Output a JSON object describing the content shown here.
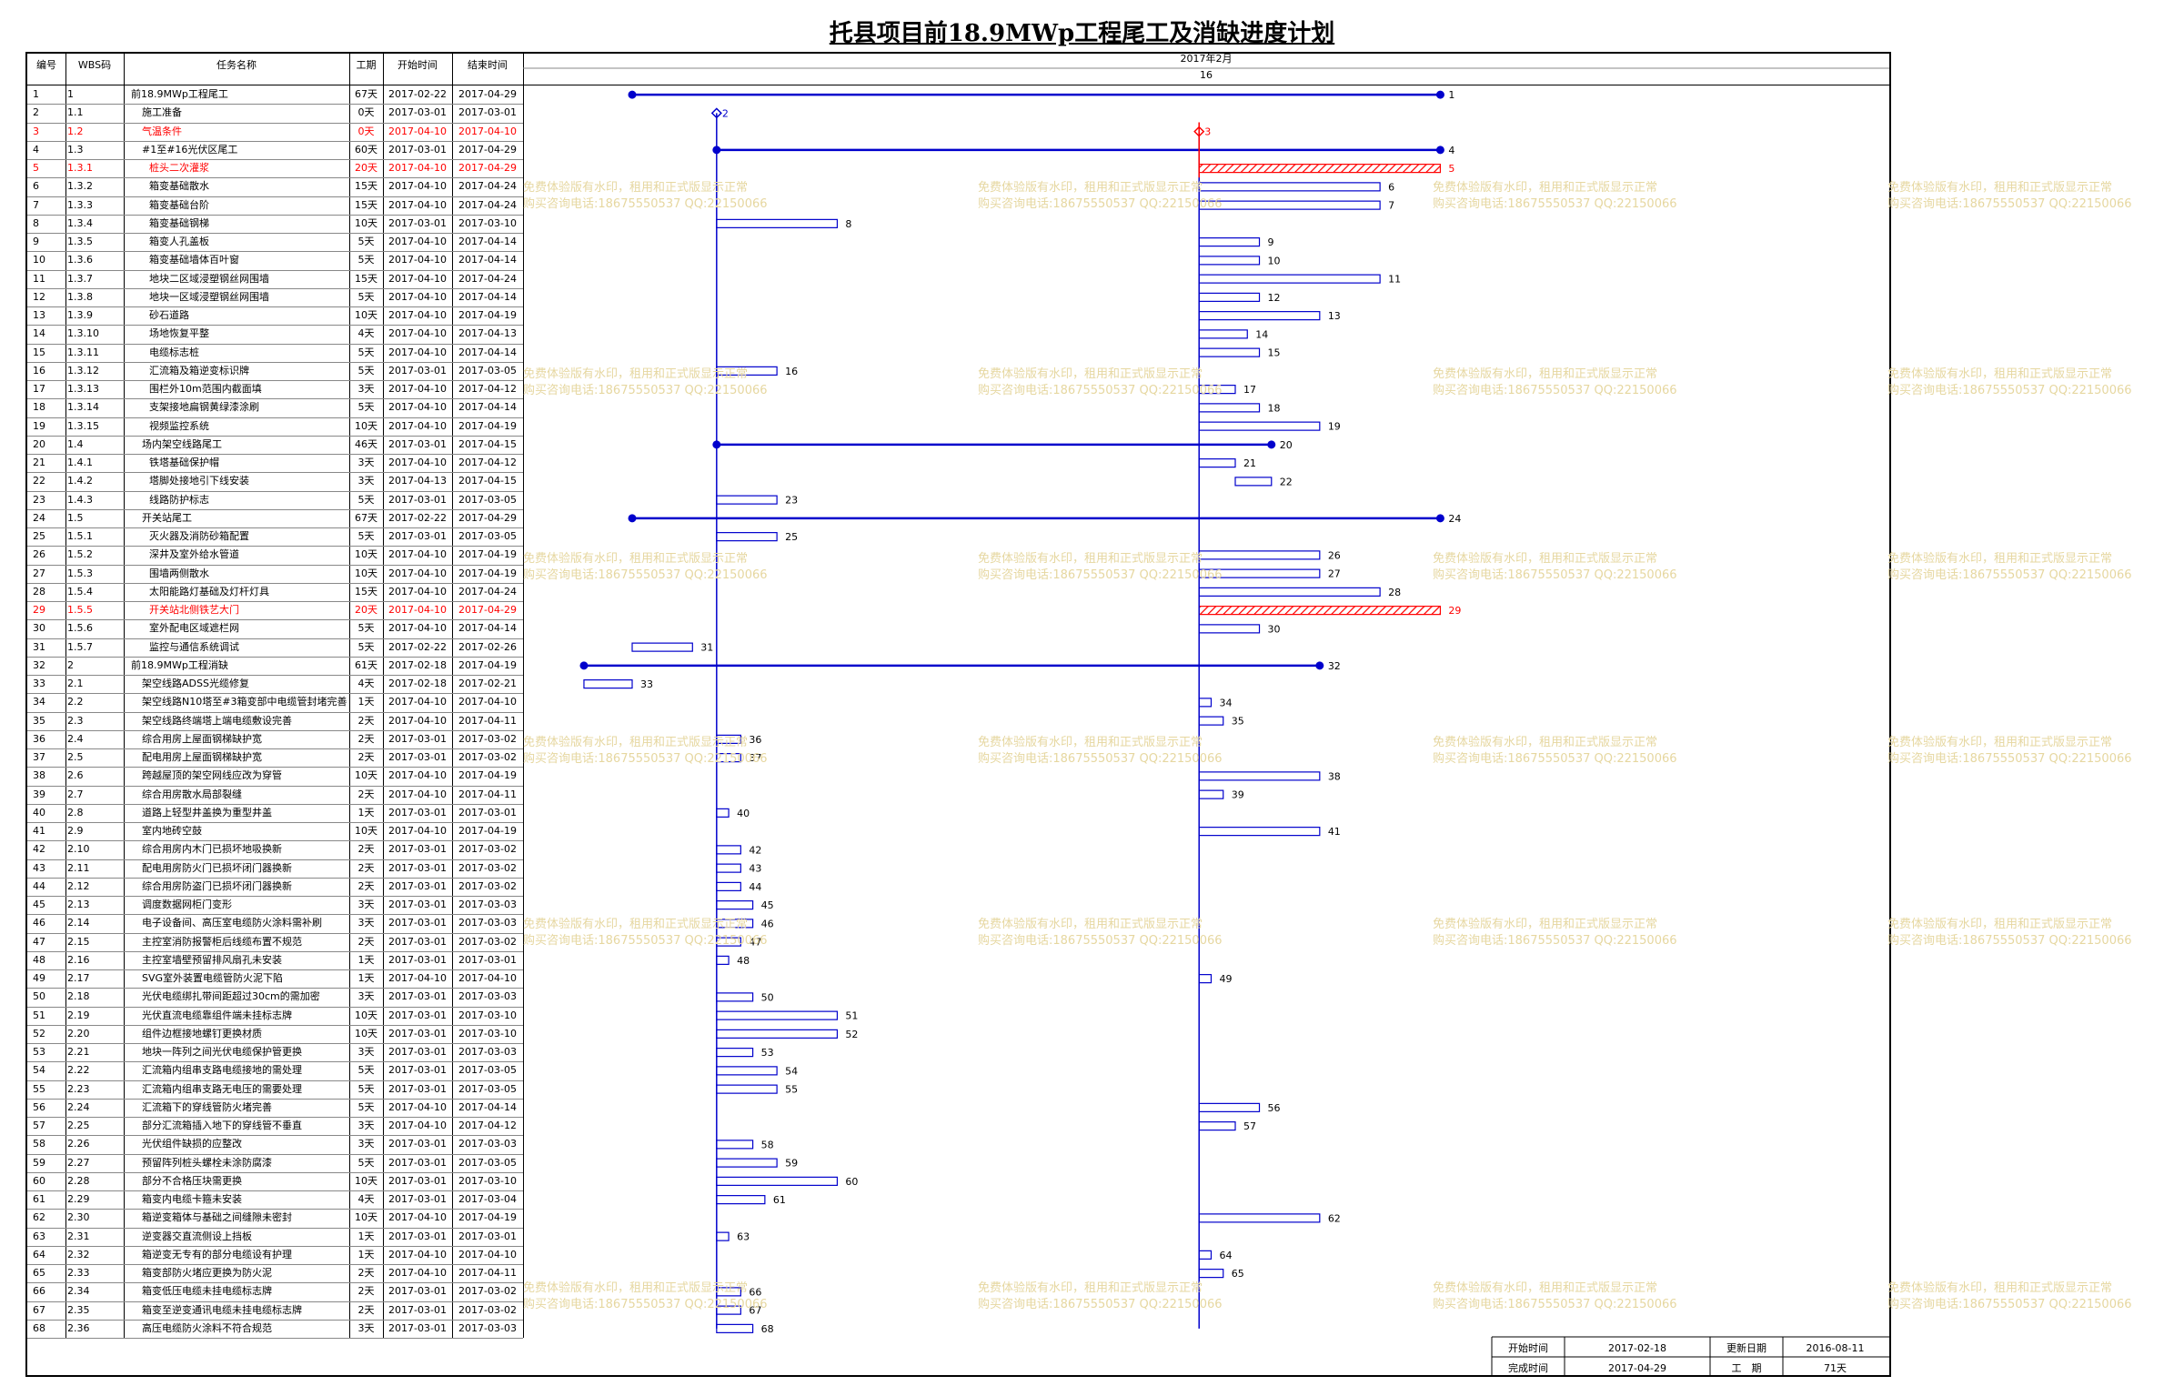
{
  "title": "托县项目前18.9MWp工程尾工及消缺进度计划",
  "headers": {
    "no": "编号",
    "wbs": "WBS码",
    "name": "任务名称",
    "dur": "工期",
    "start": "开始时间",
    "end": "结束时间",
    "month": "2017年2月",
    "week": "16"
  },
  "tasks": [
    {
      "no": "1",
      "wbs": "1",
      "name": "前18.9MWp工程尾工",
      "dur": "67天",
      "start": "2017-02-22",
      "end": "2017-04-29",
      "kind": "summary",
      "indent": 0
    },
    {
      "no": "2",
      "wbs": "1.1",
      "name": "施工准备",
      "dur": "0天",
      "start": "2017-03-01",
      "end": "2017-03-01",
      "kind": "milestone",
      "indent": 1
    },
    {
      "no": "3",
      "wbs": "1.2",
      "name": "气温条件",
      "dur": "0天",
      "start": "2017-04-10",
      "end": "2017-04-10",
      "kind": "milestone",
      "indent": 1,
      "critical": true
    },
    {
      "no": "4",
      "wbs": "1.3",
      "name": "#1至#16光伏区尾工",
      "dur": "60天",
      "start": "2017-03-01",
      "end": "2017-04-29",
      "kind": "summary",
      "indent": 1
    },
    {
      "no": "5",
      "wbs": "1.3.1",
      "name": "桩头二次灌浆",
      "dur": "20天",
      "start": "2017-04-10",
      "end": "2017-04-29",
      "kind": "task",
      "indent": 2,
      "critical": true
    },
    {
      "no": "6",
      "wbs": "1.3.2",
      "name": "箱变基础散水",
      "dur": "15天",
      "start": "2017-04-10",
      "end": "2017-04-24",
      "kind": "task",
      "indent": 2
    },
    {
      "no": "7",
      "wbs": "1.3.3",
      "name": "箱变基础台阶",
      "dur": "15天",
      "start": "2017-04-10",
      "end": "2017-04-24",
      "kind": "task",
      "indent": 2
    },
    {
      "no": "8",
      "wbs": "1.3.4",
      "name": "箱变基础钢梯",
      "dur": "10天",
      "start": "2017-03-01",
      "end": "2017-03-10",
      "kind": "task",
      "indent": 2
    },
    {
      "no": "9",
      "wbs": "1.3.5",
      "name": "箱变人孔盖板",
      "dur": "5天",
      "start": "2017-04-10",
      "end": "2017-04-14",
      "kind": "task",
      "indent": 2
    },
    {
      "no": "10",
      "wbs": "1.3.6",
      "name": "箱变基础墙体百叶窗",
      "dur": "5天",
      "start": "2017-04-10",
      "end": "2017-04-14",
      "kind": "task",
      "indent": 2
    },
    {
      "no": "11",
      "wbs": "1.3.7",
      "name": "地块二区域浸塑钢丝网围墙",
      "dur": "15天",
      "start": "2017-04-10",
      "end": "2017-04-24",
      "kind": "task",
      "indent": 2
    },
    {
      "no": "12",
      "wbs": "1.3.8",
      "name": "地块一区域浸塑钢丝网围墙",
      "dur": "5天",
      "start": "2017-04-10",
      "end": "2017-04-14",
      "kind": "task",
      "indent": 2
    },
    {
      "no": "13",
      "wbs": "1.3.9",
      "name": "砂石道路",
      "dur": "10天",
      "start": "2017-04-10",
      "end": "2017-04-19",
      "kind": "task",
      "indent": 2
    },
    {
      "no": "14",
      "wbs": "1.3.10",
      "name": "场地恢复平整",
      "dur": "4天",
      "start": "2017-04-10",
      "end": "2017-04-13",
      "kind": "task",
      "indent": 2
    },
    {
      "no": "15",
      "wbs": "1.3.11",
      "name": "电缆标志桩",
      "dur": "5天",
      "start": "2017-04-10",
      "end": "2017-04-14",
      "kind": "task",
      "indent": 2
    },
    {
      "no": "16",
      "wbs": "1.3.12",
      "name": "汇流箱及箱逆变标识牌",
      "dur": "5天",
      "start": "2017-03-01",
      "end": "2017-03-05",
      "kind": "task",
      "indent": 2
    },
    {
      "no": "17",
      "wbs": "1.3.13",
      "name": "围栏外10m范围内截面填",
      "dur": "3天",
      "start": "2017-04-10",
      "end": "2017-04-12",
      "kind": "task",
      "indent": 2
    },
    {
      "no": "18",
      "wbs": "1.3.14",
      "name": "支架接地扁钢黄绿漆涂刷",
      "dur": "5天",
      "start": "2017-04-10",
      "end": "2017-04-14",
      "kind": "task",
      "indent": 2
    },
    {
      "no": "19",
      "wbs": "1.3.15",
      "name": "视频监控系统",
      "dur": "10天",
      "start": "2017-04-10",
      "end": "2017-04-19",
      "kind": "task",
      "indent": 2
    },
    {
      "no": "20",
      "wbs": "1.4",
      "name": "场内架空线路尾工",
      "dur": "46天",
      "start": "2017-03-01",
      "end": "2017-04-15",
      "kind": "summary",
      "indent": 1
    },
    {
      "no": "21",
      "wbs": "1.4.1",
      "name": "铁塔基础保护帽",
      "dur": "3天",
      "start": "2017-04-10",
      "end": "2017-04-12",
      "kind": "task",
      "indent": 2
    },
    {
      "no": "22",
      "wbs": "1.4.2",
      "name": "塔脚处接地引下线安装",
      "dur": "3天",
      "start": "2017-04-13",
      "end": "2017-04-15",
      "kind": "task",
      "indent": 2
    },
    {
      "no": "23",
      "wbs": "1.4.3",
      "name": "线路防护标志",
      "dur": "5天",
      "start": "2017-03-01",
      "end": "2017-03-05",
      "kind": "task",
      "indent": 2
    },
    {
      "no": "24",
      "wbs": "1.5",
      "name": "开关站尾工",
      "dur": "67天",
      "start": "2017-02-22",
      "end": "2017-04-29",
      "kind": "summary",
      "indent": 1
    },
    {
      "no": "25",
      "wbs": "1.5.1",
      "name": "灭火器及消防砂箱配置",
      "dur": "5天",
      "start": "2017-03-01",
      "end": "2017-03-05",
      "kind": "task",
      "indent": 2
    },
    {
      "no": "26",
      "wbs": "1.5.2",
      "name": "深井及室外给水管道",
      "dur": "10天",
      "start": "2017-04-10",
      "end": "2017-04-19",
      "kind": "task",
      "indent": 2
    },
    {
      "no": "27",
      "wbs": "1.5.3",
      "name": "围墙两侧散水",
      "dur": "10天",
      "start": "2017-04-10",
      "end": "2017-04-19",
      "kind": "task",
      "indent": 2
    },
    {
      "no": "28",
      "wbs": "1.5.4",
      "name": "太阳能路灯基础及灯杆灯具",
      "dur": "15天",
      "start": "2017-04-10",
      "end": "2017-04-24",
      "kind": "task",
      "indent": 2
    },
    {
      "no": "29",
      "wbs": "1.5.5",
      "name": "开关站北侧铁艺大门",
      "dur": "20天",
      "start": "2017-04-10",
      "end": "2017-04-29",
      "kind": "task",
      "indent": 2,
      "critical": true
    },
    {
      "no": "30",
      "wbs": "1.5.6",
      "name": "室外配电区域遮栏网",
      "dur": "5天",
      "start": "2017-04-10",
      "end": "2017-04-14",
      "kind": "task",
      "indent": 2
    },
    {
      "no": "31",
      "wbs": "1.5.7",
      "name": "监控与通信系统调试",
      "dur": "5天",
      "start": "2017-02-22",
      "end": "2017-02-26",
      "kind": "task",
      "indent": 2
    },
    {
      "no": "32",
      "wbs": "2",
      "name": "前18.9MWp工程消缺",
      "dur": "61天",
      "start": "2017-02-18",
      "end": "2017-04-19",
      "kind": "summary",
      "indent": 0
    },
    {
      "no": "33",
      "wbs": "2.1",
      "name": "架空线路ADSS光缆修复",
      "dur": "4天",
      "start": "2017-02-18",
      "end": "2017-02-21",
      "kind": "task",
      "indent": 1
    },
    {
      "no": "34",
      "wbs": "2.2",
      "name": "架空线路N10塔至#3箱变部中电缆管封堵完善",
      "dur": "1天",
      "start": "2017-04-10",
      "end": "2017-04-10",
      "kind": "task",
      "indent": 1
    },
    {
      "no": "35",
      "wbs": "2.3",
      "name": "架空线路终端塔上端电缆敷设完善",
      "dur": "2天",
      "start": "2017-04-10",
      "end": "2017-04-11",
      "kind": "task",
      "indent": 1
    },
    {
      "no": "36",
      "wbs": "2.4",
      "name": "综合用房上屋面钢梯缺护宽",
      "dur": "2天",
      "start": "2017-03-01",
      "end": "2017-03-02",
      "kind": "task",
      "indent": 1
    },
    {
      "no": "37",
      "wbs": "2.5",
      "name": "配电用房上屋面钢梯缺护宽",
      "dur": "2天",
      "start": "2017-03-01",
      "end": "2017-03-02",
      "kind": "task",
      "indent": 1
    },
    {
      "no": "38",
      "wbs": "2.6",
      "name": "跨越屋顶的架空网线应改为穿管",
      "dur": "10天",
      "start": "2017-04-10",
      "end": "2017-04-19",
      "kind": "task",
      "indent": 1
    },
    {
      "no": "39",
      "wbs": "2.7",
      "name": "综合用房散水局部裂缝",
      "dur": "2天",
      "start": "2017-04-10",
      "end": "2017-04-11",
      "kind": "task",
      "indent": 1
    },
    {
      "no": "40",
      "wbs": "2.8",
      "name": "道路上轻型井盖换为重型井盖",
      "dur": "1天",
      "start": "2017-03-01",
      "end": "2017-03-01",
      "kind": "task",
      "indent": 1
    },
    {
      "no": "41",
      "wbs": "2.9",
      "name": "室内地砖空鼓",
      "dur": "10天",
      "start": "2017-04-10",
      "end": "2017-04-19",
      "kind": "task",
      "indent": 1
    },
    {
      "no": "42",
      "wbs": "2.10",
      "name": "综合用房内木门已损坏地吸换新",
      "dur": "2天",
      "start": "2017-03-01",
      "end": "2017-03-02",
      "kind": "task",
      "indent": 1
    },
    {
      "no": "43",
      "wbs": "2.11",
      "name": "配电用房防火门已损坏闭门器换新",
      "dur": "2天",
      "start": "2017-03-01",
      "end": "2017-03-02",
      "kind": "task",
      "indent": 1
    },
    {
      "no": "44",
      "wbs": "2.12",
      "name": "综合用房防盗门已损坏闭门器换新",
      "dur": "2天",
      "start": "2017-03-01",
      "end": "2017-03-02",
      "kind": "task",
      "indent": 1
    },
    {
      "no": "45",
      "wbs": "2.13",
      "name": "调度数据网柜门变形",
      "dur": "3天",
      "start": "2017-03-01",
      "end": "2017-03-03",
      "kind": "task",
      "indent": 1
    },
    {
      "no": "46",
      "wbs": "2.14",
      "name": "电子设备间、高压室电缆防火涂料需补刷",
      "dur": "3天",
      "start": "2017-03-01",
      "end": "2017-03-03",
      "kind": "task",
      "indent": 1
    },
    {
      "no": "47",
      "wbs": "2.15",
      "name": "主控室消防报警柜后线缆布置不规范",
      "dur": "2天",
      "start": "2017-03-01",
      "end": "2017-03-02",
      "kind": "task",
      "indent": 1
    },
    {
      "no": "48",
      "wbs": "2.16",
      "name": "主控室墙壁预留排风扇孔未安装",
      "dur": "1天",
      "start": "2017-03-01",
      "end": "2017-03-01",
      "kind": "task",
      "indent": 1
    },
    {
      "no": "49",
      "wbs": "2.17",
      "name": "SVG室外装置电缆管防火泥下陷",
      "dur": "1天",
      "start": "2017-04-10",
      "end": "2017-04-10",
      "kind": "task",
      "indent": 1
    },
    {
      "no": "50",
      "wbs": "2.18",
      "name": "光伏电缆绑扎带间距超过30cm的需加密",
      "dur": "3天",
      "start": "2017-03-01",
      "end": "2017-03-03",
      "kind": "task",
      "indent": 1
    },
    {
      "no": "51",
      "wbs": "2.19",
      "name": "光伏直流电缆靠组件端未挂标志牌",
      "dur": "10天",
      "start": "2017-03-01",
      "end": "2017-03-10",
      "kind": "task",
      "indent": 1
    },
    {
      "no": "52",
      "wbs": "2.20",
      "name": "组件边框接地螺钉更换材质",
      "dur": "10天",
      "start": "2017-03-01",
      "end": "2017-03-10",
      "kind": "task",
      "indent": 1
    },
    {
      "no": "53",
      "wbs": "2.21",
      "name": "地块一阵列之间光伏电缆保护管更换",
      "dur": "3天",
      "start": "2017-03-01",
      "end": "2017-03-03",
      "kind": "task",
      "indent": 1
    },
    {
      "no": "54",
      "wbs": "2.22",
      "name": "汇流箱内组串支路电缆接地的需处理",
      "dur": "5天",
      "start": "2017-03-01",
      "end": "2017-03-05",
      "kind": "task",
      "indent": 1
    },
    {
      "no": "55",
      "wbs": "2.23",
      "name": "汇流箱内组串支路无电压的需要处理",
      "dur": "5天",
      "start": "2017-03-01",
      "end": "2017-03-05",
      "kind": "task",
      "indent": 1
    },
    {
      "no": "56",
      "wbs": "2.24",
      "name": "汇流箱下的穿线管防火堵完善",
      "dur": "5天",
      "start": "2017-04-10",
      "end": "2017-04-14",
      "kind": "task",
      "indent": 1
    },
    {
      "no": "57",
      "wbs": "2.25",
      "name": "部分汇流箱插入地下的穿线管不垂直",
      "dur": "3天",
      "start": "2017-04-10",
      "end": "2017-04-12",
      "kind": "task",
      "indent": 1
    },
    {
      "no": "58",
      "wbs": "2.26",
      "name": "光伏组件缺损的应整改",
      "dur": "3天",
      "start": "2017-03-01",
      "end": "2017-03-03",
      "kind": "task",
      "indent": 1
    },
    {
      "no": "59",
      "wbs": "2.27",
      "name": "预留阵列桩头螺栓未涂防腐漆",
      "dur": "5天",
      "start": "2017-03-01",
      "end": "2017-03-05",
      "kind": "task",
      "indent": 1
    },
    {
      "no": "60",
      "wbs": "2.28",
      "name": "部分不合格压块需更换",
      "dur": "10天",
      "start": "2017-03-01",
      "end": "2017-03-10",
      "kind": "task",
      "indent": 1
    },
    {
      "no": "61",
      "wbs": "2.29",
      "name": "箱变内电缆卡箍未安装",
      "dur": "4天",
      "start": "2017-03-01",
      "end": "2017-03-04",
      "kind": "task",
      "indent": 1
    },
    {
      "no": "62",
      "wbs": "2.30",
      "name": "箱逆变箱体与基础之间缝隙未密封",
      "dur": "10天",
      "start": "2017-04-10",
      "end": "2017-04-19",
      "kind": "task",
      "indent": 1
    },
    {
      "no": "63",
      "wbs": "2.31",
      "name": "逆变器交直流侧设上挡板",
      "dur": "1天",
      "start": "2017-03-01",
      "end": "2017-03-01",
      "kind": "task",
      "indent": 1
    },
    {
      "no": "64",
      "wbs": "2.32",
      "name": "箱逆变无专有的部分电缆设有护理",
      "dur": "1天",
      "start": "2017-04-10",
      "end": "2017-04-10",
      "kind": "task",
      "indent": 1
    },
    {
      "no": "65",
      "wbs": "2.33",
      "name": "箱变部防火堵应更换为防火泥",
      "dur": "2天",
      "start": "2017-04-10",
      "end": "2017-04-11",
      "kind": "task",
      "indent": 1
    },
    {
      "no": "66",
      "wbs": "2.34",
      "name": "箱变低压电缆未挂电缆标志牌",
      "dur": "2天",
      "start": "2017-03-01",
      "end": "2017-03-02",
      "kind": "task",
      "indent": 1
    },
    {
      "no": "67",
      "wbs": "2.35",
      "name": "箱变至逆变通讯电缆未挂电缆标志牌",
      "dur": "2天",
      "start": "2017-03-01",
      "end": "2017-03-02",
      "kind": "task",
      "indent": 1
    },
    {
      "no": "68",
      "wbs": "2.36",
      "name": "高压电缆防火涂料不符合规范",
      "dur": "3天",
      "start": "2017-03-01",
      "end": "2017-03-03",
      "kind": "task",
      "indent": 1
    }
  ],
  "footer": {
    "start_label": "开始时间",
    "start_value": "2017-02-18",
    "update_label": "更新日期",
    "update_value": "2016-08-11",
    "finish_label": "完成时间",
    "finish_value": "2017-04-29",
    "duration_label": "工　期",
    "duration_value": "71天"
  },
  "watermark": {
    "line1": "免费体验版有水印，租用和正式版显示正常",
    "line2": "购买咨询电话:18675550537 QQ:22150066"
  },
  "colors": {
    "bar": "#0000cc",
    "critical": "#ff0000",
    "watermark": "#e6d7a0"
  }
}
